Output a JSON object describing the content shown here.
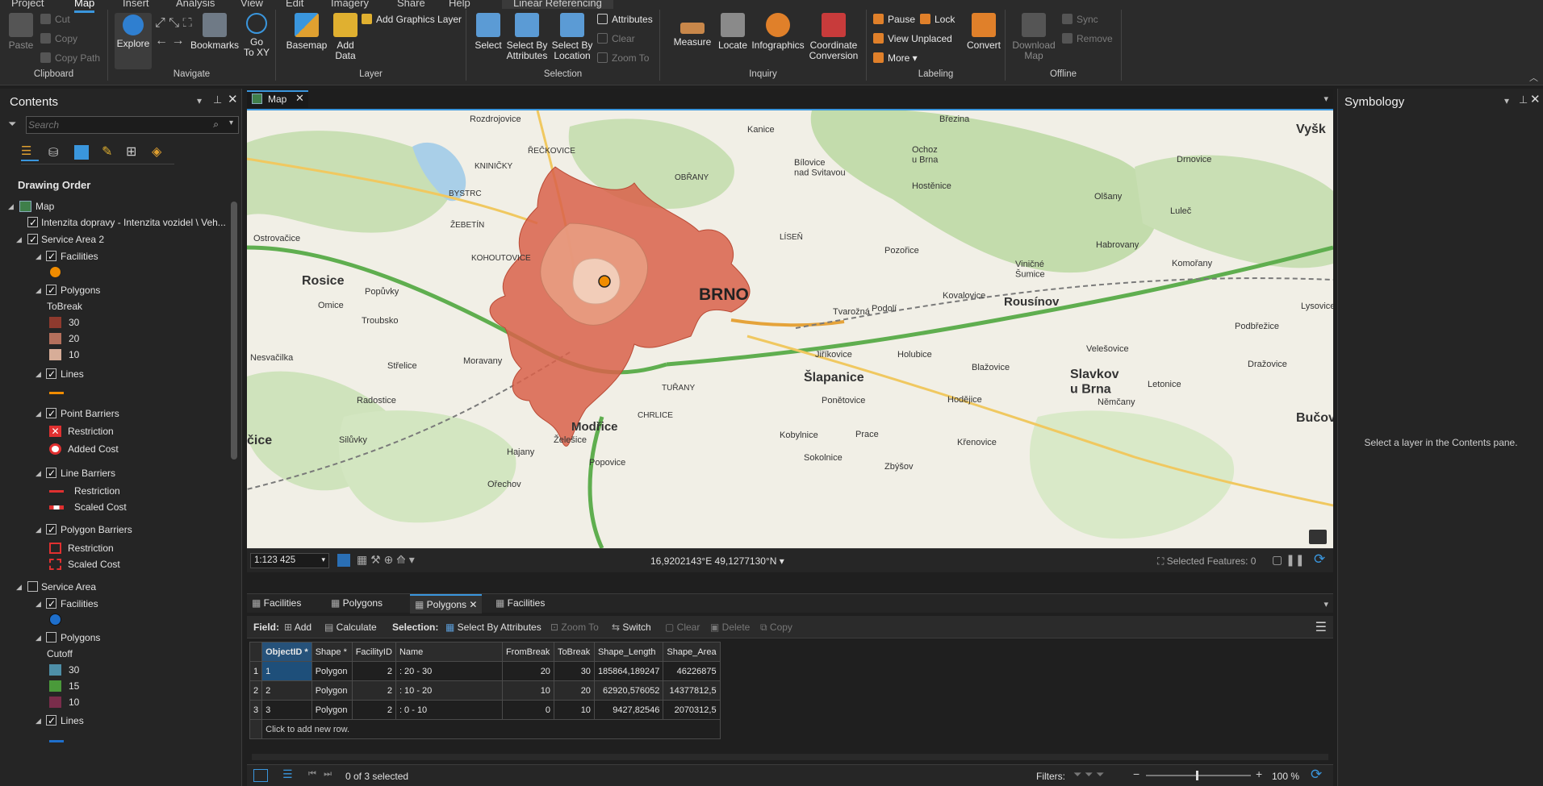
{
  "ribbon": {
    "tabs": [
      "Project",
      "Map",
      "Insert",
      "Analysis",
      "View",
      "Edit",
      "Imagery",
      "Share",
      "Help",
      "Linear Referencing"
    ],
    "clipboard": {
      "paste": "Paste",
      "cut": "Cut",
      "copy": "Copy",
      "copy_path": "Copy Path",
      "label": "Clipboard"
    },
    "navigate": {
      "explore": "Explore",
      "bookmarks": "Bookmarks",
      "goto": "Go\nTo XY",
      "label": "Navigate"
    },
    "layer": {
      "basemap": "Basemap",
      "add_data": "Add\nData",
      "add_graphics": "Add Graphics Layer",
      "label": "Layer"
    },
    "selection": {
      "select": "Select",
      "select_by_attr": "Select By\nAttributes",
      "select_by_loc": "Select By\nLocation",
      "attributes": "Attributes",
      "clear": "Clear",
      "zoom_to": "Zoom To",
      "label": "Selection"
    },
    "inquiry": {
      "measure": "Measure",
      "locate": "Locate",
      "infographics": "Infographics",
      "coord": "Coordinate\nConversion",
      "label": "Inquiry"
    },
    "labeling": {
      "pause": "Pause",
      "lock": "Lock",
      "view_unplaced": "View Unplaced",
      "more": "More",
      "convert": "Convert",
      "label": "Labeling"
    },
    "offline": {
      "download": "Download\nMap",
      "sync": "Sync",
      "remove": "Remove",
      "label": "Offline"
    }
  },
  "contents": {
    "title": "Contents",
    "search_placeholder": "Search",
    "drawing_order": "Drawing Order",
    "tree": [
      {
        "label": "Map",
        "indent": 0
      },
      {
        "label": "Intenzita dopravy - Intenzita vozidel \\ Veh...",
        "indent": 1
      },
      {
        "label": "Service Area 2",
        "indent": 1
      },
      {
        "label": "Facilities",
        "indent": 2
      },
      {
        "label": "Polygons",
        "indent": 2
      },
      {
        "label": "ToBreak",
        "indent": 3
      },
      {
        "label": "30",
        "indent": 4
      },
      {
        "label": "20",
        "indent": 4
      },
      {
        "label": "10",
        "indent": 4
      },
      {
        "label": "Lines",
        "indent": 2
      },
      {
        "label": "Point Barriers",
        "indent": 2
      },
      {
        "label": "Restriction",
        "indent": 4
      },
      {
        "label": "Added Cost",
        "indent": 4
      },
      {
        "label": "Line Barriers",
        "indent": 2
      },
      {
        "label": "Restriction",
        "indent": 4
      },
      {
        "label": "Scaled Cost",
        "indent": 4
      },
      {
        "label": "Polygon Barriers",
        "indent": 2
      },
      {
        "label": "Restriction",
        "indent": 4
      },
      {
        "label": "Scaled Cost",
        "indent": 4
      },
      {
        "label": "Service Area",
        "indent": 1
      },
      {
        "label": "Facilities",
        "indent": 2
      },
      {
        "label": "Polygons",
        "indent": 2
      },
      {
        "label": "Cutoff",
        "indent": 3
      },
      {
        "label": "30",
        "indent": 4
      },
      {
        "label": "15",
        "indent": 4
      },
      {
        "label": "10",
        "indent": 4
      },
      {
        "label": "Lines",
        "indent": 2
      }
    ],
    "colors": {
      "tb30": "#8f3a2e",
      "tb20": "#b5705c",
      "tb10": "#d7ad98",
      "cut30": "#4e8fa8",
      "cut15": "#4a9a3a",
      "cut10": "#7a2d4b",
      "facility": "#f08c00",
      "facility2": "#1e6fcc"
    }
  },
  "map": {
    "tab": "Map",
    "scale": "1:123 425",
    "coords": "16,9202143°E 49,1277130°N",
    "selected": "Selected Features: 0",
    "labels": {
      "brno": "BRNO",
      "rosice": "Rosice",
      "modrice": "Modřice",
      "slapanice": "Šlapanice",
      "slavkov": "Slavkov\nu Brna",
      "rousinov": "Rousínov",
      "vysk": "Vyšk",
      "bucov": "Bučov",
      "cice": "čice",
      "kohoutovice": "KOHOUTOVICE",
      "bystrc": "BYSTRC",
      "zebetin": "ŽEBETÍN",
      "reckovice": "ŘEČKOVICE",
      "kninicky": "KNINIČKY",
      "turany": "TUŘANY",
      "chrlice": "CHRLICE",
      "tvarozna": "Tvarožná",
      "pozorice": "Pozořice",
      "kanice": "Kanice",
      "drnovice": "Drnovice",
      "olsany": "Olšany",
      "habrovany": "Habrovany",
      "lulec": "Luleč",
      "komorany": "Komořany",
      "velesovice": "Velešovice",
      "blazovice": "Blažovice",
      "holubice": "Holubice",
      "jirikovice": "Jiříkovice",
      "ponetovice": "Ponětovice",
      "kobylnice": "Kobylnice",
      "sokolnice": "Sokolnice",
      "zelesice": "Želešice",
      "hajany": "Hajany",
      "orechov": "Ořechov",
      "popovice": "Popovice",
      "troubsko": "Troubsko",
      "strelice": "Střelice",
      "omice": "Omice",
      "popuvky": "Popůvky",
      "moravany": "Moravany",
      "silulvky": "Silůvky",
      "radostice": "Radostice",
      "ostrovacice": "Ostrovačice",
      "nesvacilka": "Nesvačilka",
      "prace": "Prace",
      "zbysov": "Zbýšov",
      "hodejice": "Hodějice",
      "krenovice": "Křenovice",
      "letonice": "Letonice",
      "nemcany": "Němčany",
      "podbrezice": "Podbřežice",
      "lysovice": "Lysovice",
      "drazovice": "Dražovice",
      "brezina": "Březina",
      "ochoz": "Ochoz\nu Brna",
      "hostenice": "Hostěnice",
      "podoli": "Podolí",
      "kovalovice": "Kovalovice",
      "vinicne": "Viničné\nŠumice",
      "bilovice": "Bílovice\nnad Svitavou",
      "rozdrojovice": "Rozdrojovice",
      "obrany": "OBŘANY",
      "lisen": "LÍSEŇ"
    }
  },
  "symbology": {
    "title": "Symbology",
    "hint": "Select a layer in the Contents pane."
  },
  "table": {
    "tabs": [
      "Facilities",
      "Polygons",
      "Polygons",
      "Facilities"
    ],
    "toolbar": {
      "field": "Field:",
      "add": "Add",
      "calculate": "Calculate",
      "selection": "Selection:",
      "select_by_attr": "Select By Attributes",
      "zoom_to": "Zoom To",
      "switch": "Switch",
      "clear": "Clear",
      "delete": "Delete",
      "copy": "Copy"
    },
    "columns": [
      "ObjectID *",
      "Shape *",
      "FacilityID",
      "Name",
      "FromBreak",
      "ToBreak",
      "Shape_Length",
      "Shape_Area"
    ],
    "rows": [
      [
        "1",
        "Polygon",
        "2",
        ": 20 - 30",
        "20",
        "30",
        "185864,189247",
        "46226875"
      ],
      [
        "2",
        "Polygon",
        "2",
        ": 10 - 20",
        "10",
        "20",
        "62920,576052",
        "14377812,5"
      ],
      [
        "3",
        "Polygon",
        "2",
        ": 0 - 10",
        "0",
        "10",
        "9427,82546",
        "2070312,5"
      ]
    ],
    "add_row": "Click to add new row.",
    "status": "0 of 3 selected",
    "filters": "Filters:",
    "zoom": "100 %"
  }
}
